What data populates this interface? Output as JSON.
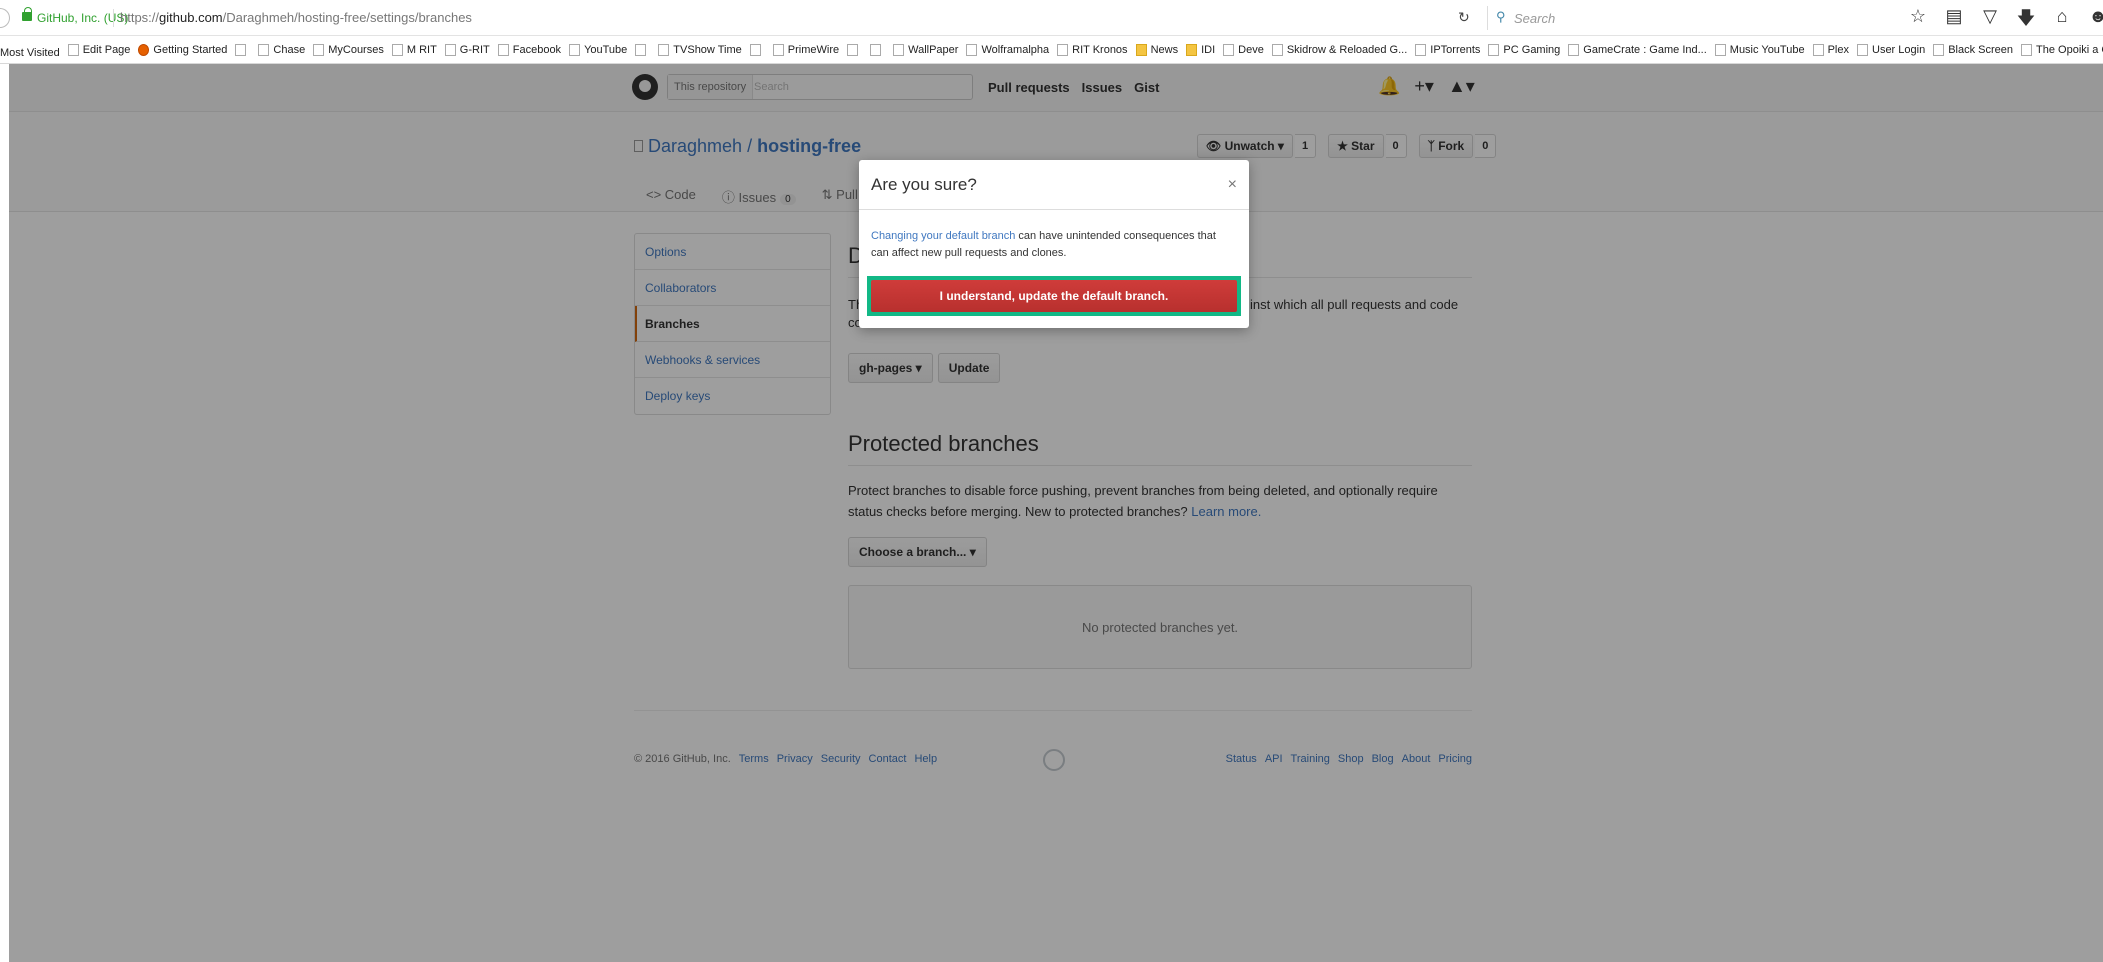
{
  "browser": {
    "identity": "GitHub, Inc. (US)",
    "url_prefix": "https://",
    "url_host": "github.com",
    "url_path": "/Daraghmeh/hosting-free/settings/branches",
    "search_placeholder": "Search",
    "reload_icon": "reload-icon",
    "toolbar_icons": [
      "star-icon",
      "reading-list-icon",
      "pocket-icon",
      "download-icon",
      "home-icon",
      "smiley-icon"
    ],
    "bookmarks": [
      {
        "label": "Most Visited",
        "icon": "page"
      },
      {
        "label": "Edit Page",
        "icon": "page"
      },
      {
        "label": "Getting Started",
        "icon": "firefox"
      },
      {
        "label": "",
        "icon": "page"
      },
      {
        "label": "Chase",
        "icon": "page"
      },
      {
        "label": "MyCourses",
        "icon": "page"
      },
      {
        "label": "M RIT",
        "icon": "page"
      },
      {
        "label": "G-RIT",
        "icon": "page"
      },
      {
        "label": "Facebook",
        "icon": "page"
      },
      {
        "label": "YouTube",
        "icon": "page"
      },
      {
        "label": "",
        "icon": "page"
      },
      {
        "label": "TVShow Time",
        "icon": "page"
      },
      {
        "label": "",
        "icon": "page"
      },
      {
        "label": "PrimeWire",
        "icon": "page"
      },
      {
        "label": "",
        "icon": "page"
      },
      {
        "label": "",
        "icon": "page"
      },
      {
        "label": "WallPaper",
        "icon": "page"
      },
      {
        "label": "Wolframalpha",
        "icon": "page"
      },
      {
        "label": "RIT Kronos",
        "icon": "page"
      },
      {
        "label": "News",
        "icon": "folder"
      },
      {
        "label": "IDI",
        "icon": "folder"
      },
      {
        "label": "Deve",
        "icon": "page"
      },
      {
        "label": "Skidrow & Reloaded G...",
        "icon": "page"
      },
      {
        "label": "IPTorrents",
        "icon": "page"
      },
      {
        "label": "PC Gaming",
        "icon": "page"
      },
      {
        "label": "GameCrate : Game Ind...",
        "icon": "page"
      },
      {
        "label": "Music YouTube",
        "icon": "page"
      },
      {
        "label": "Plex",
        "icon": "page"
      },
      {
        "label": "User Login",
        "icon": "page"
      },
      {
        "label": "Black Screen",
        "icon": "page"
      },
      {
        "label": "The Opoiki a Corporat...",
        "icon": "page"
      }
    ]
  },
  "header": {
    "search_scope": "This repository",
    "search_placeholder": "Search",
    "nav": [
      "Pull requests",
      "Issues",
      "Gist"
    ],
    "icons": [
      "bell-icon",
      "plus-icon",
      "avatar-icon"
    ]
  },
  "repo": {
    "owner": "Daraghmeh",
    "separator": " / ",
    "name": "hosting-free",
    "watch_label": "Unwatch",
    "watch_count": "1",
    "star_label": "Star",
    "star_count": "0",
    "fork_label": "Fork",
    "fork_count": "0",
    "tabs": [
      {
        "label": "Code",
        "count": ""
      },
      {
        "label": "Issues",
        "count": "0"
      },
      {
        "label": "Pull req",
        "count": ""
      }
    ]
  },
  "settings": {
    "menu": [
      "Options",
      "Collaborators",
      "Branches",
      "Webhooks & services",
      "Deploy keys"
    ],
    "active_index": 2,
    "default_heading_visible": "D",
    "default_text_left": "Th",
    "default_text_right": "inst which all pull requests and code",
    "default_text_line2": "co",
    "branch_select": "gh-pages",
    "update_button": "Update",
    "protected_heading": "Protected branches",
    "protected_desc": "Protect branches to disable force pushing, prevent branches from being deleted, and optionally require status checks before merging. New to protected branches?",
    "learn_more": "Learn more.",
    "choose_branch": "Choose a branch...",
    "no_protected": "No protected branches yet."
  },
  "footer": {
    "copyright": "© 2016 GitHub, Inc.",
    "left_links": [
      "Terms",
      "Privacy",
      "Security",
      "Contact",
      "Help"
    ],
    "right_links": [
      "Status",
      "API",
      "Training",
      "Shop",
      "Blog",
      "About",
      "Pricing"
    ]
  },
  "modal": {
    "title": "Are you sure?",
    "close": "×",
    "link_text": "Changing your default branch",
    "body_text": " can have unintended consequences that can affect new pull requests and clones.",
    "confirm_label": "I understand, update the default branch."
  }
}
